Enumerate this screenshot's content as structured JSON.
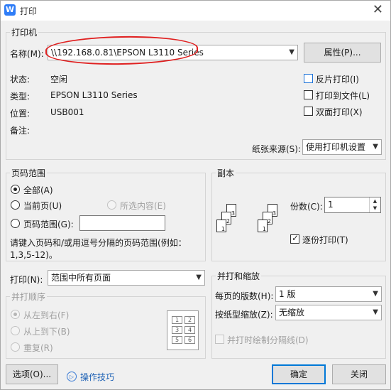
{
  "window": {
    "title": "打印",
    "app_icon": "W"
  },
  "printer": {
    "legend": "打印机",
    "name_label": "名称(M):",
    "name_value": "\\\\192.168.0.81\\EPSON L3110 Series",
    "properties_label": "属性(P)...",
    "status_label": "状态:",
    "status_value": "空闲",
    "type_label": "类型:",
    "type_value": "EPSON L3110 Series",
    "location_label": "位置:",
    "location_value": "USB001",
    "comment_label": "备注:",
    "reverse_label": "反片打印(I)",
    "tofile_label": "打印到文件(L)",
    "duplex_label": "双面打印(X)",
    "paper_source_label": "纸张来源(S):",
    "paper_source_value": "使用打印机设置"
  },
  "range": {
    "legend": "页码范围",
    "all_label": "全部(A)",
    "current_label": "当前页(U)",
    "selection_label": "所选内容(E)",
    "pages_label": "页码范围(G):",
    "pages_value": "",
    "hint": "请键入页码和/或用逗号分隔的页码范围(例如：",
    "hint2": "1,3,5-12)。"
  },
  "copies": {
    "legend": "副本",
    "count_label": "份数(C):",
    "count_value": "1",
    "collate_label": "逐份打印(T)",
    "icon_pages": [
      "3",
      "2",
      "1",
      "3",
      "2",
      "1"
    ]
  },
  "print_what": {
    "label": "打印(N):",
    "value": "范围中所有页面"
  },
  "order": {
    "legend": "并打顺序",
    "lr_label": "从左到右(F)",
    "tb_label": "从上到下(B)",
    "repeat_label": "重复(R)",
    "cells": [
      "1",
      "2",
      "3",
      "4",
      "5",
      "6"
    ]
  },
  "zoom": {
    "legend": "并打和缩放",
    "per_sheet_label": "每页的版数(H):",
    "per_sheet_value": "1 版",
    "scale_label": "按纸型缩放(Z):",
    "scale_value": "无缩放",
    "divider_label": "并打时绘制分隔线(D)"
  },
  "footer": {
    "options_label": "选项(O)...",
    "tips_label": "操作技巧",
    "ok_label": "确定",
    "close_label": "关闭"
  },
  "colors": {
    "accent": "#0078d7",
    "annotation": "#e02020"
  }
}
